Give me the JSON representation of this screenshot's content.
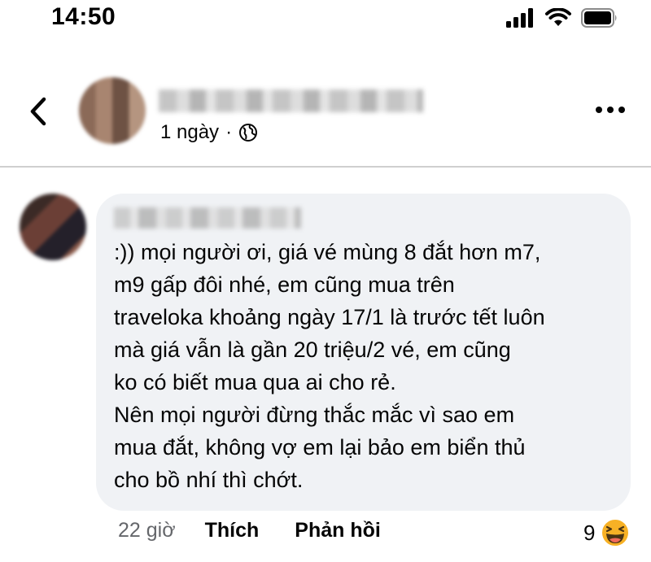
{
  "status_bar": {
    "time": "14:50"
  },
  "post": {
    "time_ago": "1 ngày",
    "separator": "·",
    "privacy_icon": "globe-icon"
  },
  "comment": {
    "lines": [
      ":)) mọi người ơi, giá vé mùng 8 đắt hơn m7,",
      "m9 gấp đôi nhé, em cũng mua trên",
      "traveloka khoảng ngày 17/1 là trước tết luôn",
      "mà giá vẫn là gần 20 triệu/2 vé, em cũng",
      "ko có biết mua qua ai cho rẻ.",
      "Nên mọi người đừng thắc mắc vì sao em",
      "mua đắt, không vợ em lại bảo em biển thủ",
      "cho bồ nhí thì chớt."
    ],
    "time_ago": "22 giờ",
    "like_label": "Thích",
    "reply_label": "Phản hồi",
    "reaction_count": "9",
    "reaction_icon": "haha-emoji-icon"
  },
  "colors": {
    "bubble": "#f0f2f5",
    "meta_text": "#65676b",
    "reaction_yellow": "#f7b125"
  }
}
